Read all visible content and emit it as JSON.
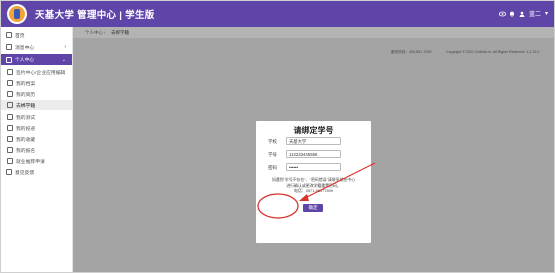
{
  "header": {
    "title": "天基大学 管理中心 | 学生版",
    "user_label": "蓝二",
    "icons": [
      "eye-icon",
      "bell-icon",
      "user-icon",
      "chevron-down-icon"
    ]
  },
  "sidebar": {
    "items": [
      {
        "label": "首页",
        "icon": "home-icon"
      },
      {
        "label": "消息中心",
        "icon": "chat-icon"
      },
      {
        "label": "个人中心",
        "icon": "user-icon"
      },
      {
        "label": "签约中心/企业应用编辑",
        "icon": "edit-icon"
      },
      {
        "label": "我的档案",
        "icon": "doc-icon"
      },
      {
        "label": "我的简历",
        "icon": "doc-icon"
      },
      {
        "label": "去绑学籍",
        "icon": "list-icon"
      },
      {
        "label": "我的测试",
        "icon": "test-icon"
      },
      {
        "label": "我的投递",
        "icon": "send-icon"
      },
      {
        "label": "我的收藏",
        "icon": "star-icon"
      },
      {
        "label": "我的报名",
        "icon": "form-icon"
      },
      {
        "label": "就业推荐申请",
        "icon": "apply-icon"
      },
      {
        "label": "意见反馈",
        "icon": "feedback-icon"
      }
    ]
  },
  "breadcrumb": {
    "home": "个人中心",
    "separator": "›",
    "current": "去绑学籍"
  },
  "footer": {
    "phone": "服务热线：400-651-7299",
    "copyright": "Copyright © 2021 GoHold.io. All Rights Reserved.   1.2.19.0"
  },
  "modal": {
    "title": "请绑定学号",
    "school_label": "学校",
    "school_value": "天基大学",
    "student_id_label": "学号",
    "student_id_value": "112233445566",
    "password_label": "密码",
    "password_value": "••••••",
    "note_lines": [
      "如遇到\"学号不存在\"、\"密码错误\"请联系就业中心",
      "进行确认或更改学籍重置密码。",
      "电话：0571-86077899"
    ],
    "confirm_label": "确定"
  },
  "colors": {
    "brand": "#5f45a8",
    "overlay": "#a4a4a4",
    "annotation": "#d9332b"
  }
}
